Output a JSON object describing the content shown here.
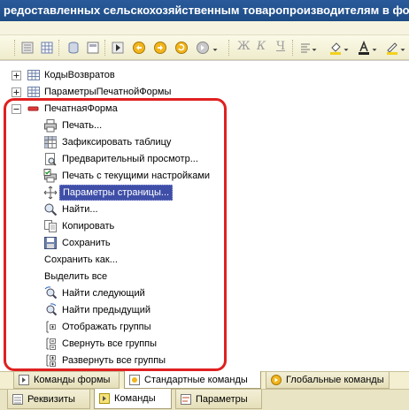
{
  "title": "редоставленных сельскохозяйственным товаропроизводителям в форме суб",
  "toolbar": {
    "font_glyphs": [
      "Ж",
      "К",
      "Ч"
    ]
  },
  "tree": {
    "items": [
      {
        "label": "КодыВозвратов",
        "icon": "table-icon"
      },
      {
        "label": "ПараметрыПечатнойФормы",
        "icon": "table-icon"
      },
      {
        "label": "ПечатнаяФорма",
        "icon": "minus-icon"
      }
    ],
    "commands": [
      {
        "label": "Печать...",
        "icon": "printer-icon"
      },
      {
        "label": "Зафиксировать таблицу",
        "icon": "freeze-table-icon"
      },
      {
        "label": "Предварительный просмотр...",
        "icon": "preview-icon"
      },
      {
        "label": "Печать с текущими настройками",
        "icon": "print-checked-icon"
      },
      {
        "label": "Параметры страницы...",
        "icon": "page-setup-icon"
      },
      {
        "label": "Найти...",
        "icon": "find-icon"
      },
      {
        "label": "Копировать",
        "icon": "copy-icon"
      },
      {
        "label": "Сохранить",
        "icon": "save-icon"
      },
      {
        "label": "Сохранить как...",
        "icon": ""
      },
      {
        "label": "Выделить все",
        "icon": ""
      },
      {
        "label": "Найти следующий",
        "icon": "find-next-icon"
      },
      {
        "label": "Найти предыдущий",
        "icon": "find-prev-icon"
      },
      {
        "label": "Отображать группы",
        "icon": "show-groups-icon"
      },
      {
        "label": "Свернуть все группы",
        "icon": "collapse-groups-icon"
      },
      {
        "label": "Развернуть все группы",
        "icon": "expand-groups-icon"
      }
    ]
  },
  "tabs_top": [
    "Команды формы",
    "Стандартные команды",
    "Глобальные команды"
  ],
  "tabs_bottom": [
    "Реквизиты",
    "Команды",
    "Параметры"
  ],
  "colors": {
    "selection": "#3f4fa8",
    "highlight_border": "#e02020",
    "title_bar": "#1d4c86"
  }
}
